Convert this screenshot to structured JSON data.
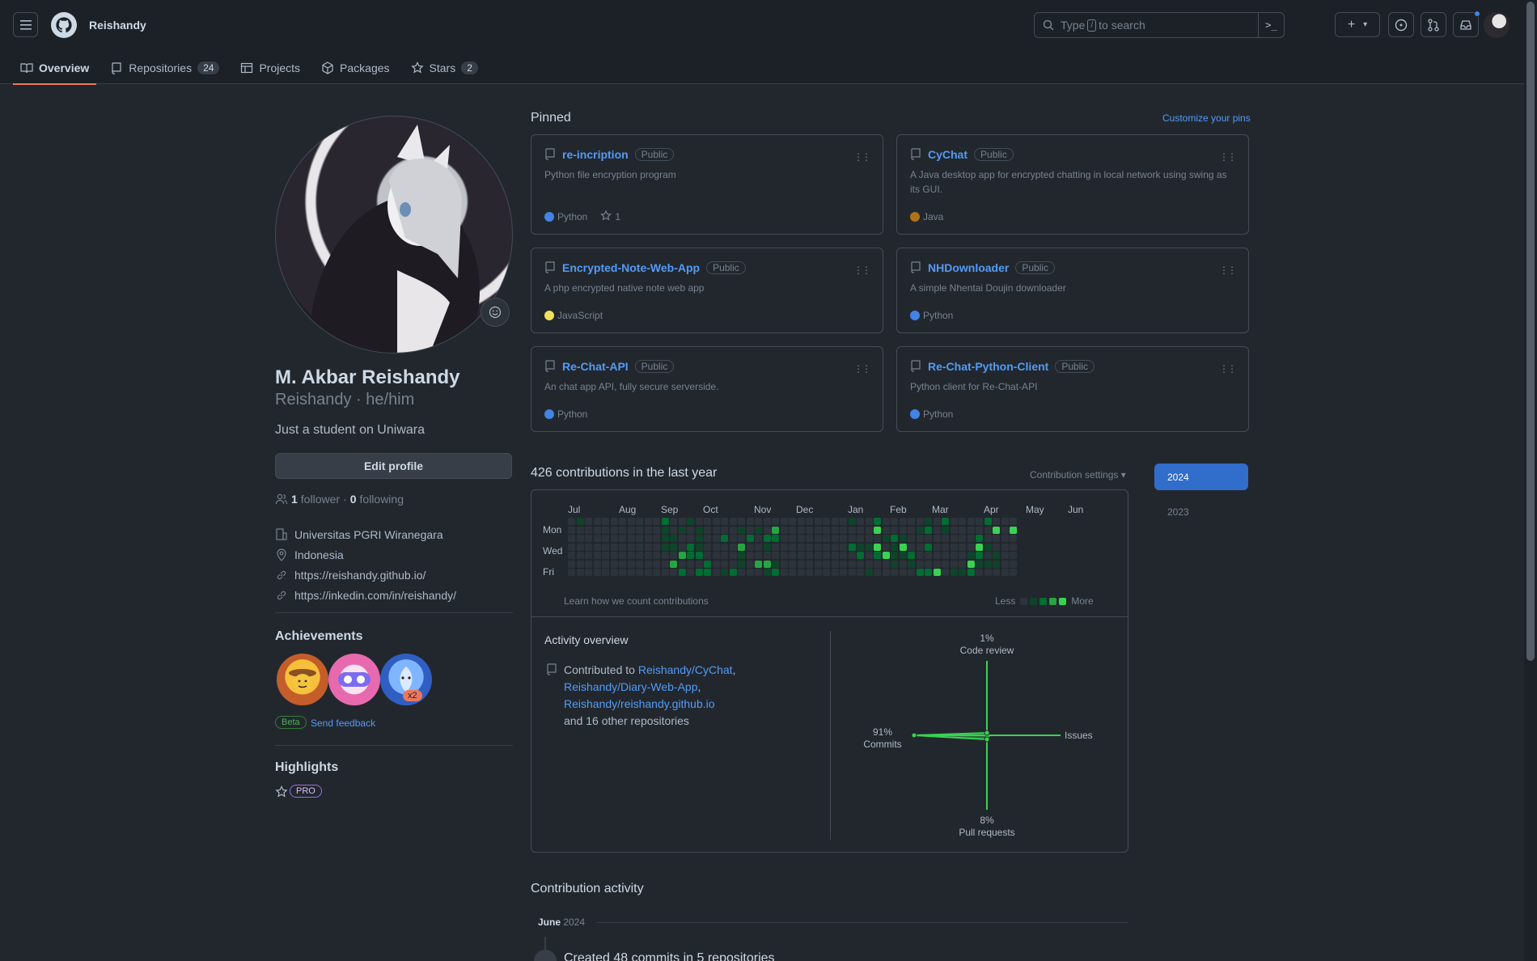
{
  "header": {
    "username": "Reishandy",
    "search_prefix": "Type",
    "search_key": "/",
    "search_suffix": "to search",
    "command_icon": ">_",
    "plus_icon": "+",
    "caret_icon": "▾"
  },
  "tabs": [
    {
      "label": "Overview",
      "icon": "book-icon",
      "active": true
    },
    {
      "label": "Repositories",
      "count": "24",
      "icon": "repo-icon"
    },
    {
      "label": "Projects",
      "icon": "table-icon"
    },
    {
      "label": "Packages",
      "icon": "package-icon"
    },
    {
      "label": "Stars",
      "count": "2",
      "icon": "star-icon"
    }
  ],
  "profile": {
    "name": "M. Akbar Reishandy",
    "login": "Reishandy · he/him",
    "bio": "Just a student on Uniwara",
    "edit_button": "Edit profile",
    "followers": "1",
    "followers_label": "follower",
    "dot": "·",
    "following": "0",
    "following_label": "following",
    "details": [
      {
        "icon": "organization-icon",
        "text": "Universitas PGRI Wiranegara"
      },
      {
        "icon": "location-icon",
        "text": "Indonesia"
      },
      {
        "icon": "link-icon",
        "text": "https://reishandy.github.io/"
      },
      {
        "icon": "link-icon",
        "text": "https://inkedin.com/in/reishandy/"
      }
    ]
  },
  "achievements": {
    "title": "Achievements",
    "multiplier": "x2",
    "beta": "Beta",
    "feedback": "Send feedback"
  },
  "highlights": {
    "title": "Highlights",
    "pro": "PRO"
  },
  "pinned": {
    "title": "Pinned",
    "customize": "Customize your pins",
    "visibility": "Public",
    "repos": [
      {
        "name": "re-incription",
        "description": "Python file encryption program",
        "language": "Python",
        "lang_color": "#4184e4",
        "stars": "1"
      },
      {
        "name": "CyChat",
        "description": "A Java desktop app for encrypted chatting in local network using swing as its GUI.",
        "language": "Java",
        "lang_color": "#b07219"
      },
      {
        "name": "Encrypted-Note-Web-App",
        "description": "A php encrypted native note web app",
        "language": "JavaScript",
        "lang_color": "#f1e05a"
      },
      {
        "name": "NHDownloader",
        "description": "A simple Nhentai Doujin downloader",
        "language": "Python",
        "lang_color": "#4184e4"
      },
      {
        "name": "Re-Chat-API",
        "description": "An chat app API, fully secure serverside.",
        "language": "Python",
        "lang_color": "#4184e4"
      },
      {
        "name": "Re-Chat-Python-Client",
        "description": "Python client for Re-Chat-API",
        "language": "Python",
        "lang_color": "#4184e4"
      }
    ]
  },
  "contributions": {
    "title": "426 contributions in the last year",
    "settings": "Contribution settings ▾",
    "years": [
      "2024",
      "2023"
    ],
    "months": [
      "Jul",
      "Aug",
      "Sep",
      "Oct",
      "Nov",
      "Dec",
      "Jan",
      "Feb",
      "Mar",
      "Apr",
      "May",
      "Jun"
    ],
    "days": [
      "Mon",
      "Wed",
      "Fri"
    ],
    "learn": "Learn how we count contributions",
    "less": "Less",
    "more": "More",
    "colors": [
      "#2d333b",
      "#0e4429",
      "#006d32",
      "#26a641",
      "#39d353"
    ]
  },
  "activity": {
    "title": "Activity overview",
    "contributed_to": "Contributed to",
    "repo1": "Reishandy/CyChat",
    "comma": ",",
    "repo2": "Reishandy/Diary-Web-App",
    "repo3": "Reishandy/reishandy.github.io",
    "others": "and 16 other repositories",
    "code_review_pct": "1%",
    "code_review": "Code review",
    "commits_pct": "91%",
    "commits": "Commits",
    "issues": "Issues",
    "pr_pct": "8%",
    "pull_requests": "Pull requests"
  },
  "contribution_activity": {
    "title": "Contribution activity",
    "month": "June",
    "year": "2024",
    "item": "Created 48 commits in 5 repositories"
  }
}
